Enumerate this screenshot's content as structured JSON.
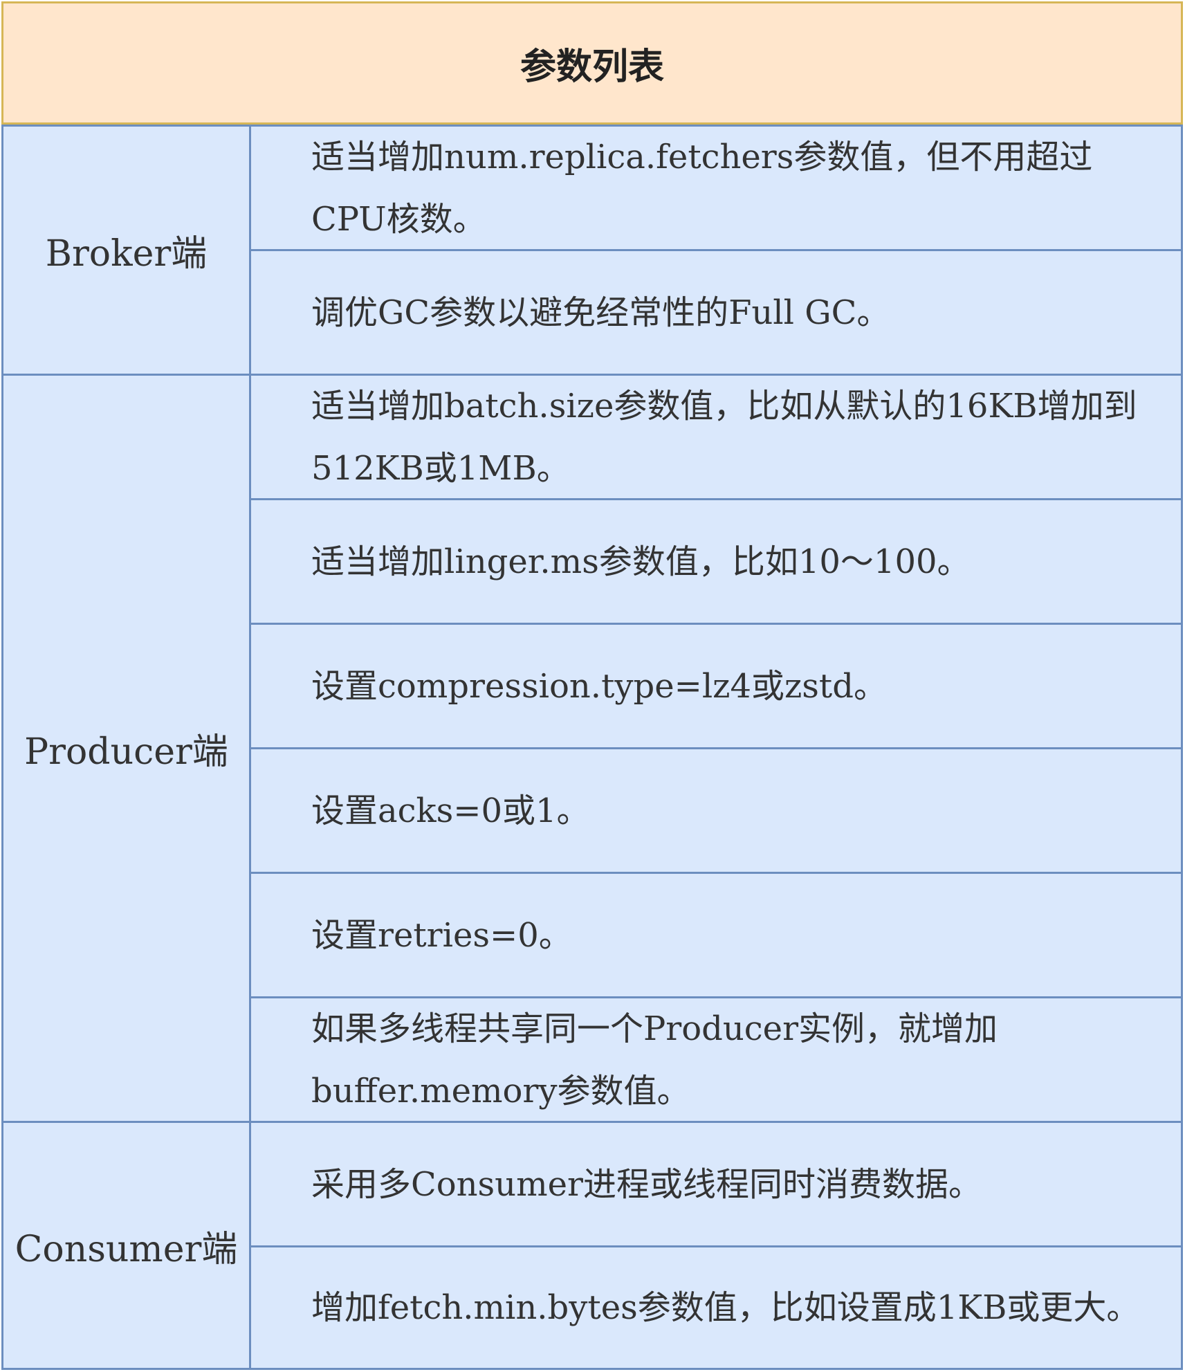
{
  "table": {
    "title": "参数列表",
    "groups": [
      {
        "label": "Broker端",
        "items": [
          "适当增加num.replica.fetchers参数值，但不用超过CPU核数。",
          "调优GC参数以避免经常性的Full GC。"
        ]
      },
      {
        "label": "Producer端",
        "items": [
          "适当增加batch.size参数值，比如从默认的16KB增加到512KB或1MB。",
          "适当增加linger.ms参数值，比如10～100。",
          "设置compression.type=lz4或zstd。",
          "设置acks=0或1。",
          "设置retries=0。",
          "如果多线程共享同一个Producer实例，就增加buffer.memory参数值。"
        ]
      },
      {
        "label": "Consumer端",
        "items": [
          "采用多Consumer进程或线程同时消费数据。",
          "增加fetch.min.bytes参数值，比如设置成1KB或更大。"
        ]
      }
    ]
  },
  "colors": {
    "header_bg": "#ffe6cc",
    "header_border": "#d6b656",
    "cell_bg": "#dae8fc",
    "cell_border": "#6c8ebf"
  }
}
